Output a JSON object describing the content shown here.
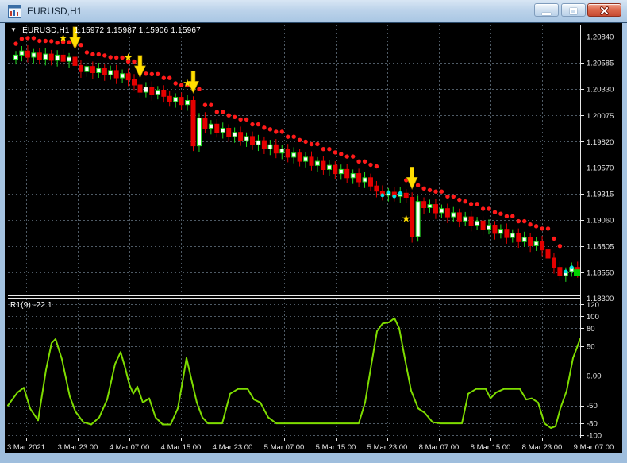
{
  "window": {
    "title": "EURUSD,H1",
    "controls": {
      "minimize": "minimize",
      "restore": "restore",
      "close": "close"
    }
  },
  "chart_header": {
    "dropdown_glyph": "▼",
    "symbol": "EURUSD,H1",
    "open": "1.15972",
    "high": "1.15987",
    "low": "1.15906",
    "close": "1.15967"
  },
  "indicator_header": {
    "name": "R1(9)",
    "value": "-22.1"
  },
  "chart_data": {
    "type": "candlestick",
    "symbol": "EURUSD",
    "timeframe": "H1",
    "price_axis": {
      "ticks": [
        "1.20840",
        "1.20585",
        "1.20330",
        "1.20075",
        "1.19820",
        "1.19570",
        "1.19315",
        "1.19060",
        "1.18805",
        "1.18550",
        "1.18300"
      ],
      "ylim": [
        1.18328,
        1.20956
      ],
      "current_price": 1.1855
    },
    "time_axis": {
      "labels": [
        "3 Mar 2021",
        "3 Mar 23:00",
        "4 Mar 07:00",
        "4 Mar 15:00",
        "4 Mar 23:00",
        "5 Mar 07:00",
        "5 Mar 15:00",
        "5 Mar 23:00",
        "8 Mar 07:00",
        "8 Mar 15:00",
        "8 Mar 23:00",
        "9 Mar 07:00"
      ]
    },
    "candles": {
      "first_open": 1.2062,
      "closes": [
        1.2066,
        1.207,
        1.2064,
        1.2068,
        1.2062,
        1.2067,
        1.2061,
        1.2066,
        1.206,
        1.2064,
        1.2056,
        1.205,
        1.2055,
        1.2049,
        1.2053,
        1.2047,
        1.2051,
        1.2044,
        1.2048,
        1.2042,
        1.2037,
        1.203,
        1.2035,
        1.2028,
        1.2032,
        1.2026,
        1.2021,
        1.2025,
        1.2018,
        1.2022,
        1.1978,
        1.2005,
        1.1995,
        1.1999,
        1.1991,
        1.1995,
        1.1987,
        1.1991,
        1.1983,
        1.1987,
        1.1979,
        1.1983,
        1.1975,
        1.1979,
        1.1971,
        1.1975,
        1.1967,
        1.1971,
        1.1963,
        1.1967,
        1.1959,
        1.1963,
        1.1955,
        1.1959,
        1.1951,
        1.1955,
        1.1947,
        1.1951,
        1.1943,
        1.1947,
        1.1939,
        1.1934,
        1.193,
        1.1933,
        1.1929,
        1.1932,
        1.1928,
        1.189,
        1.1924,
        1.1918,
        1.1921,
        1.1913,
        1.1917,
        1.1909,
        1.1913,
        1.1905,
        1.1909,
        1.1901,
        1.1905,
        1.1897,
        1.1901,
        1.1893,
        1.1897,
        1.1889,
        1.1893,
        1.1885,
        1.1889,
        1.1881,
        1.1885,
        1.1877,
        1.1869,
        1.186,
        1.1852,
        1.1856,
        1.186,
        1.1856
      ]
    },
    "trend_dots": {
      "red_zones": [
        [
          0,
          61
        ],
        [
          66,
          92
        ]
      ],
      "cyan_zones": [
        [
          62,
          65
        ],
        [
          93,
          95
        ]
      ]
    },
    "signal_arrows": [
      10,
      21,
      30,
      67
    ],
    "signal_stars": [
      {
        "bar": 8,
        "place": "above"
      },
      {
        "bar": 19,
        "place": "above"
      },
      {
        "bar": 29,
        "place": "above"
      },
      {
        "bar": 66,
        "place": "below"
      }
    ],
    "indicator": {
      "name": "R1(9)",
      "value": -22.1,
      "axis_ticks": [
        {
          "label": "120",
          "v": 120
        },
        {
          "label": "100",
          "v": 100
        },
        {
          "label": "80",
          "v": 80
        },
        {
          "label": "50",
          "v": 50
        },
        {
          "label": "0.00",
          "v": 0
        },
        {
          "label": "-50",
          "v": -50
        },
        {
          "label": "-80",
          "v": -80
        },
        {
          "label": "-100",
          "v": -100
        }
      ],
      "ylim": [
        -104,
        130
      ],
      "points": [
        [
          10,
          -50
        ],
        [
          22,
          -28
        ],
        [
          30,
          -20
        ],
        [
          38,
          -55
        ],
        [
          48,
          -75
        ],
        [
          58,
          10
        ],
        [
          65,
          55
        ],
        [
          70,
          62
        ],
        [
          78,
          28
        ],
        [
          88,
          -35
        ],
        [
          95,
          -60
        ],
        [
          105,
          -78
        ],
        [
          115,
          -82
        ],
        [
          125,
          -70
        ],
        [
          135,
          -40
        ],
        [
          145,
          20
        ],
        [
          152,
          40
        ],
        [
          158,
          12
        ],
        [
          163,
          -15
        ],
        [
          168,
          -30
        ],
        [
          173,
          -18
        ],
        [
          180,
          -45
        ],
        [
          188,
          -38
        ],
        [
          196,
          -70
        ],
        [
          205,
          -82
        ],
        [
          215,
          -82
        ],
        [
          224,
          -55
        ],
        [
          230,
          -10
        ],
        [
          235,
          30
        ],
        [
          241,
          -5
        ],
        [
          248,
          -45
        ],
        [
          255,
          -70
        ],
        [
          262,
          -80
        ],
        [
          280,
          -80
        ],
        [
          290,
          -30
        ],
        [
          300,
          -22
        ],
        [
          312,
          -22
        ],
        [
          320,
          -40
        ],
        [
          328,
          -45
        ],
        [
          338,
          -70
        ],
        [
          348,
          -80
        ],
        [
          452,
          -80
        ],
        [
          460,
          -45
        ],
        [
          468,
          20
        ],
        [
          475,
          75
        ],
        [
          482,
          88
        ],
        [
          490,
          90
        ],
        [
          497,
          97
        ],
        [
          503,
          80
        ],
        [
          510,
          30
        ],
        [
          518,
          -25
        ],
        [
          527,
          -55
        ],
        [
          535,
          -62
        ],
        [
          545,
          -78
        ],
        [
          555,
          -80
        ],
        [
          582,
          -80
        ],
        [
          590,
          -30
        ],
        [
          600,
          -22
        ],
        [
          612,
          -22
        ],
        [
          618,
          -38
        ],
        [
          625,
          -28
        ],
        [
          635,
          -22
        ],
        [
          655,
          -22
        ],
        [
          663,
          -40
        ],
        [
          670,
          -38
        ],
        [
          678,
          -45
        ],
        [
          686,
          -80
        ],
        [
          694,
          -88
        ],
        [
          700,
          -85
        ],
        [
          706,
          -55
        ],
        [
          714,
          -25
        ],
        [
          722,
          30
        ],
        [
          731,
          62
        ]
      ]
    },
    "colors": {
      "background": "#000000",
      "foreground": "#E8E8E8",
      "grid": "#4f5b66",
      "bull_candle": "#22DD22",
      "bull_fill": "#FFFFFF",
      "bear_candle": "#E60000",
      "trend_dot_red": "#FF1A1A",
      "trend_dot_cyan": "#00E5E5",
      "signal_yellow": "#FFDE00",
      "indicator_line": "#7EDC00",
      "bid_marker": "#00D200"
    }
  }
}
